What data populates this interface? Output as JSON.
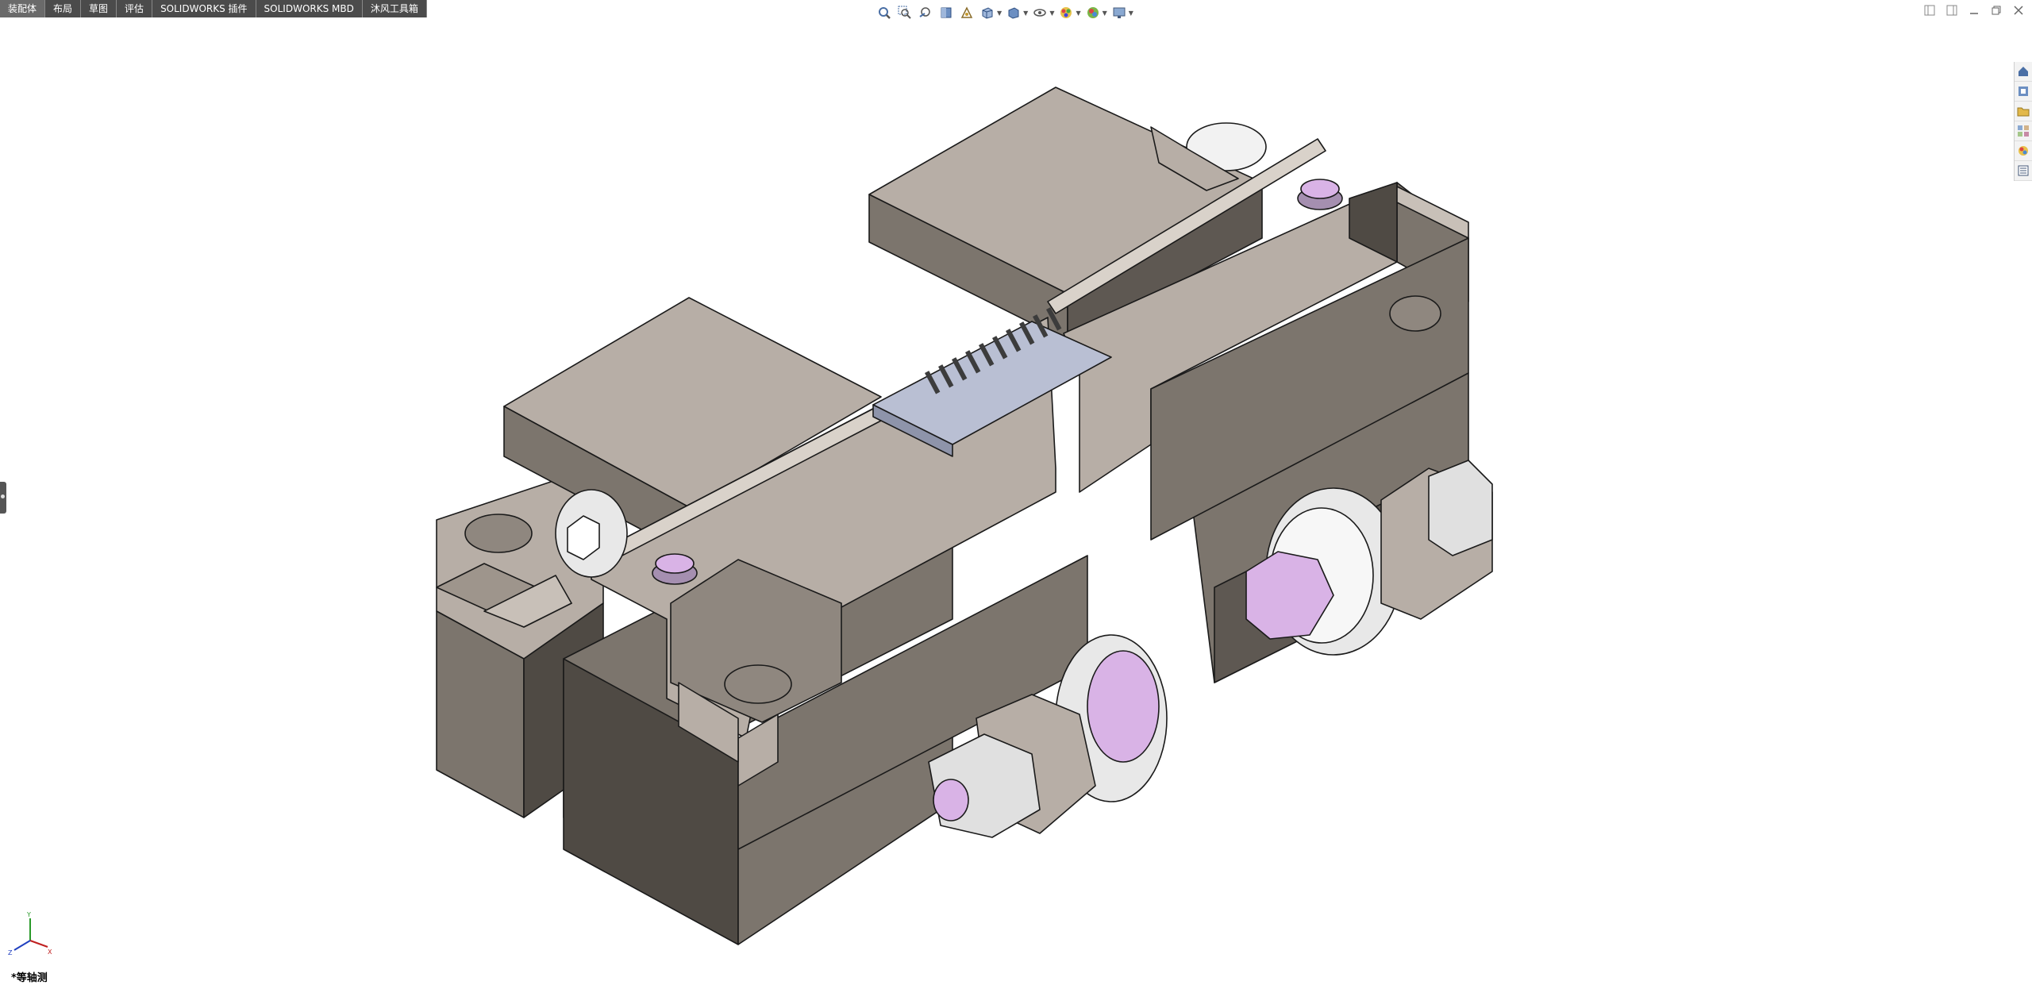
{
  "tabs": [
    "装配体",
    "布局",
    "草图",
    "评估",
    "SOLIDWORKS 插件",
    "SOLIDWORKS MBD",
    "沐风工具箱"
  ],
  "view_toolbar": {
    "icons": [
      "zoom-to-fit-icon",
      "zoom-to-area-icon",
      "previous-view-icon",
      "section-view-icon",
      "dynamic-annotation-icon",
      "view-orientation-icon",
      "display-style-icon",
      "hide-show-items-icon",
      "edit-appearance-icon",
      "apply-scene-icon",
      "view-settings-icon"
    ]
  },
  "task_pane": {
    "icons": [
      "solidworks-resources-icon",
      "design-library-icon",
      "file-explorer-icon",
      "view-palette-icon",
      "appearances-scenes-icon",
      "custom-properties-icon"
    ]
  },
  "view_label": "*等轴测",
  "triad_axes": [
    "X",
    "Y",
    "Z"
  ],
  "colors": {
    "tab_bg": "#4b4b4b",
    "part_light": "#b7aea6",
    "part_mid": "#7c756d",
    "part_dark": "#4f4a44",
    "pin_purple": "#d9b3e6",
    "bearing": "#e8e8e8",
    "connector": "#b9bfd3"
  }
}
